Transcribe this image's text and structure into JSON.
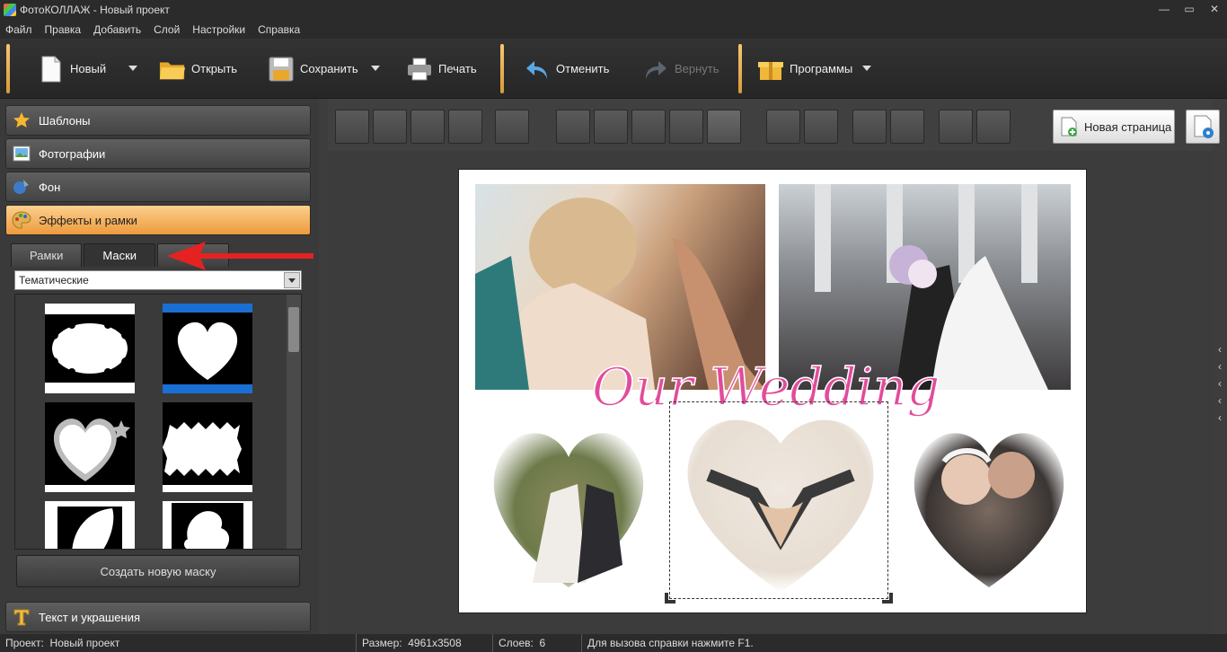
{
  "window": {
    "title": "ФотоКОЛЛАЖ - Новый проект"
  },
  "menu": [
    "Файл",
    "Правка",
    "Добавить",
    "Слой",
    "Настройки",
    "Справка"
  ],
  "toolbar": {
    "new": "Новый",
    "open": "Открыть",
    "save": "Сохранить",
    "print": "Печать",
    "undo": "Отменить",
    "redo": "Вернуть",
    "programs": "Программы"
  },
  "sidebar": {
    "templates": "Шаблоны",
    "photos": "Фотографии",
    "background": "Фон",
    "effects": "Эффекты и рамки",
    "text": "Текст и украшения"
  },
  "effects_panel": {
    "tabs": [
      "Рамки",
      "Маски"
    ],
    "category": "Тематические",
    "create_mask": "Создать новую маску"
  },
  "canvas_toolbar": {
    "new_page": "Новая страница"
  },
  "collage": {
    "caption": "Our Wedding"
  },
  "status": {
    "project_label": "Проект:",
    "project_name": "Новый проект",
    "size_label": "Размер:",
    "size": "4961x3508",
    "layers_label": "Слоев:",
    "layers": "6",
    "help": "Для вызова справки нажмите F1."
  },
  "colors": {
    "accent": "#f3a64a",
    "annotation_arrow": "#e52222",
    "caption_pink": "#e24b9b"
  }
}
